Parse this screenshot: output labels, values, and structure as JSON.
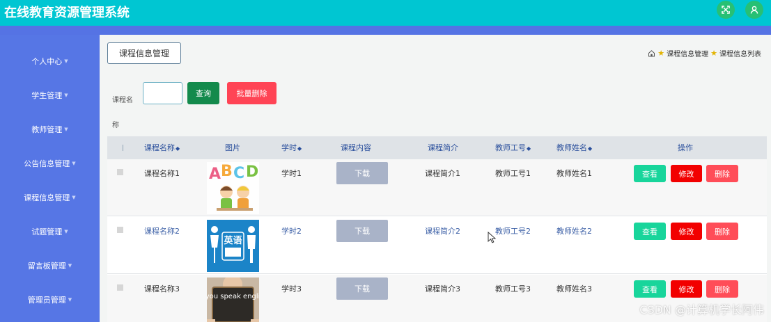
{
  "app": {
    "title": "在线教育资源管理系统"
  },
  "header_icons": [
    {
      "name": "fullscreen-icon"
    },
    {
      "name": "user-icon"
    }
  ],
  "sidebar": {
    "items": [
      {
        "label": "个人中心"
      },
      {
        "label": "学生管理"
      },
      {
        "label": "教师管理"
      },
      {
        "label": "公告信息管理"
      },
      {
        "label": "课程信息管理"
      },
      {
        "label": "试题管理"
      },
      {
        "label": "留言板管理"
      },
      {
        "label": "管理员管理"
      }
    ]
  },
  "page": {
    "title": "课程信息管理",
    "breadcrumb": [
      "课程信息管理",
      "课程信息列表"
    ]
  },
  "search": {
    "label_line1": "课程名",
    "label_line2": "称",
    "value": "",
    "query_label": "查询",
    "batch_delete_label": "批量删除"
  },
  "table": {
    "headers": {
      "name": "课程名称",
      "image": "图片",
      "hours": "学时",
      "content": "课程内容",
      "intro": "课程简介",
      "teacher_no": "教师工号",
      "teacher_name": "教师姓名",
      "actions": "操作"
    },
    "rows": [
      {
        "name": "课程名称1",
        "image_icon": "abcd-kids-image",
        "hours": "学时1",
        "content": "下载",
        "intro": "课程简介1",
        "teacher_no": "教师工号1",
        "teacher_name": "教师姓名1",
        "view": "查看",
        "edit": "修改",
        "del": "删除"
      },
      {
        "name": "课程名称2",
        "image_icon": "english-sign-image",
        "image_text": "英语",
        "hours": "学时2",
        "content": "下载",
        "intro": "课程简介2",
        "teacher_no": "教师工号2",
        "teacher_name": "教师姓名2",
        "view": "查看",
        "edit": "修改",
        "del": "删除"
      },
      {
        "name": "课程名称3",
        "image_icon": "do-you-speak-english-image",
        "image_text": "Do you speak english?",
        "hours": "学时3",
        "content": "下载",
        "intro": "课程简介3",
        "teacher_no": "教师工号3",
        "teacher_name": "教师姓名3",
        "view": "查看",
        "edit": "修改",
        "del": "删除"
      }
    ]
  },
  "watermark": "CSDN @计算机学长阿伟",
  "colors": {
    "topbar": "#00c6d2",
    "sidebar": "#5676e5",
    "query": "#138a4c",
    "batch_delete": "#ff4455",
    "view": "#18d59b",
    "edit": "#f20000",
    "delete": "#ff4d58"
  }
}
